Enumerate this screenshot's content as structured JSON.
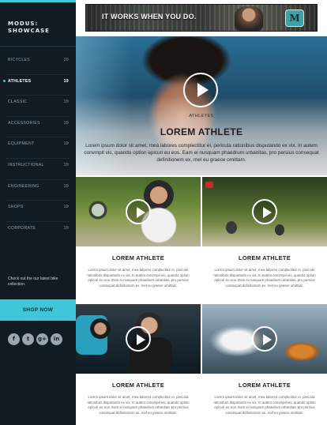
{
  "brand": {
    "name": "MODUS: SHOWCASE"
  },
  "sidebar": {
    "items": [
      {
        "label": "BICYCLES",
        "count": "20",
        "active": false
      },
      {
        "label": "ATHLETES",
        "count": "19",
        "active": true
      },
      {
        "label": "CLASSIC",
        "count": "19",
        "active": false
      },
      {
        "label": "ACCESSORIES",
        "count": "19",
        "active": false
      },
      {
        "label": "EQUIPMENT",
        "count": "19",
        "active": false
      },
      {
        "label": "INSTRUCTIONAL",
        "count": "19",
        "active": false
      },
      {
        "label": "ENGINEERING",
        "count": "19",
        "active": false
      },
      {
        "label": "SHOPS",
        "count": "19",
        "active": false
      },
      {
        "label": "CORPORATE",
        "count": "19",
        "active": false
      }
    ],
    "promo_text": "Check out the our latest bike collection.",
    "shop_button": "SHOP NOW",
    "social": [
      {
        "icon": "facebook-icon",
        "glyph": "f"
      },
      {
        "icon": "twitter-icon",
        "glyph": "t"
      },
      {
        "icon": "google-plus-icon",
        "glyph": "g+"
      },
      {
        "icon": "linkedin-icon",
        "glyph": "in"
      }
    ]
  },
  "banner": {
    "tagline": "IT WORKS WHEN YOU DO.",
    "badge": "M"
  },
  "hero": {
    "kicker": "ATHLETES",
    "title": "LOREM ATHLETE",
    "description": "Lorem ipsum dolor sit amet, mea labores complectitur ei, pericula rationibus disputando ex vix. In autem convmpit vis, quando option epicuri eu eos. Eam ei nusquam phaedrum urbanitas, pro persius consequat definitionem ex, mel eu graece omittam."
  },
  "cards": [
    {
      "title": "LOREM ATHLETE",
      "text": "Lorem ipsum dolor sit amet, mea labores complectitur ei, pericula rationibus disputando ex vix. In autem convmpit vis, quando option epicuri eu eos. Eam ei nusquam phaedrum urbanitas, pro persius consequat definitionem ex, mel eu graece omittam."
    },
    {
      "title": "LOREM ATHLETE",
      "text": "Lorem ipsum dolor sit amet, mea labores complectitur ei, pericula rationibus disputando ex vix. In autem convmpit vis, quando option epicuri eu eos. Eam ei nusquam phaedrum urbanitas, pro persius consequat definitionem ex, mel eu graece omittam."
    },
    {
      "title": "LOREM ATHLETE",
      "text": "Lorem ipsum dolor sit amet, mea labores complectitur ei, pericula rationibus disputando ex vix. In autem convmpit vis, quando option epicuri eu eos. Eam ei nusquam phaedrum urbanitas, pro persius consequat definitionem ex, mel eu graece omittam."
    },
    {
      "title": "LOREM ATHLETE",
      "text": "Lorem ipsum dolor sit amet, mea labores complectitur ei, pericula rationibus disputando ex vix. In autem convmpit vis, quando option epicuri eu eos. Eam ei nusquam phaedrum urbanitas, pro persius consequat definitionem ex, mel eu graece omittam."
    }
  ],
  "colors": {
    "accent": "#3fc6d8",
    "sidebar_bg": "#121b22"
  }
}
